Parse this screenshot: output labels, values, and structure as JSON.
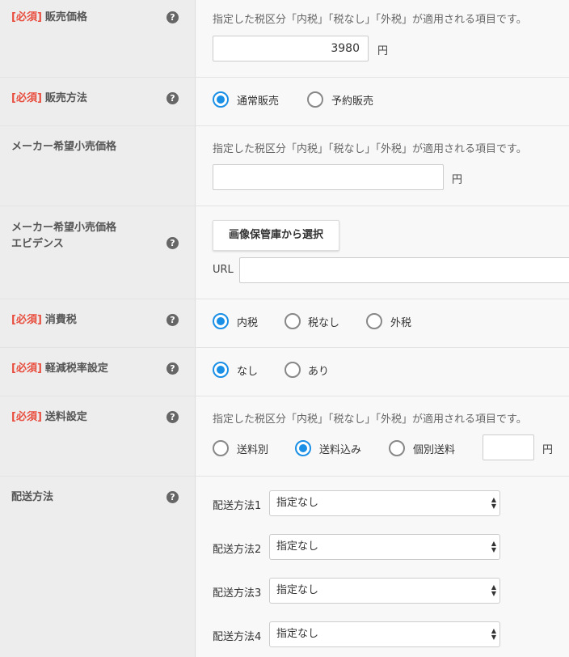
{
  "required_tag": "[必須]",
  "help_icon": "question-circle-icon",
  "tax_note": "指定した税区分「内税」「税なし」「外税」が適用される項目です。",
  "yen": "円",
  "sale_price": {
    "label": "販売価格",
    "value": "3980"
  },
  "sale_method": {
    "label": "販売方法",
    "options": [
      "通常販売",
      "予約販売"
    ],
    "selected": "通常販売"
  },
  "msrp": {
    "label": "メーカー希望小売価格",
    "value": ""
  },
  "msrp_evidence": {
    "label_line1": "メーカー希望小売価格",
    "label_line2": "エビデンス",
    "button": "画像保管庫から選択",
    "url_label": "URL",
    "url_value": ""
  },
  "consumption_tax": {
    "label": "消費税",
    "options": [
      "内税",
      "税なし",
      "外税"
    ],
    "selected": "内税"
  },
  "reduced_tax": {
    "label": "軽減税率設定",
    "options": [
      "なし",
      "あり"
    ],
    "selected": "なし"
  },
  "shipping_fee": {
    "label": "送料設定",
    "options": [
      "送料別",
      "送料込み",
      "個別送料"
    ],
    "selected": "送料込み",
    "custom_value": ""
  },
  "delivery": {
    "label": "配送方法",
    "methods": [
      {
        "label": "配送方法1",
        "value": "指定なし"
      },
      {
        "label": "配送方法2",
        "value": "指定なし"
      },
      {
        "label": "配送方法3",
        "value": "指定なし"
      },
      {
        "label": "配送方法4",
        "value": "指定なし"
      }
    ]
  },
  "colors": {
    "required": "#e84d3d",
    "radio_checked": "#1a8fe6",
    "label_bg": "#ededed"
  }
}
